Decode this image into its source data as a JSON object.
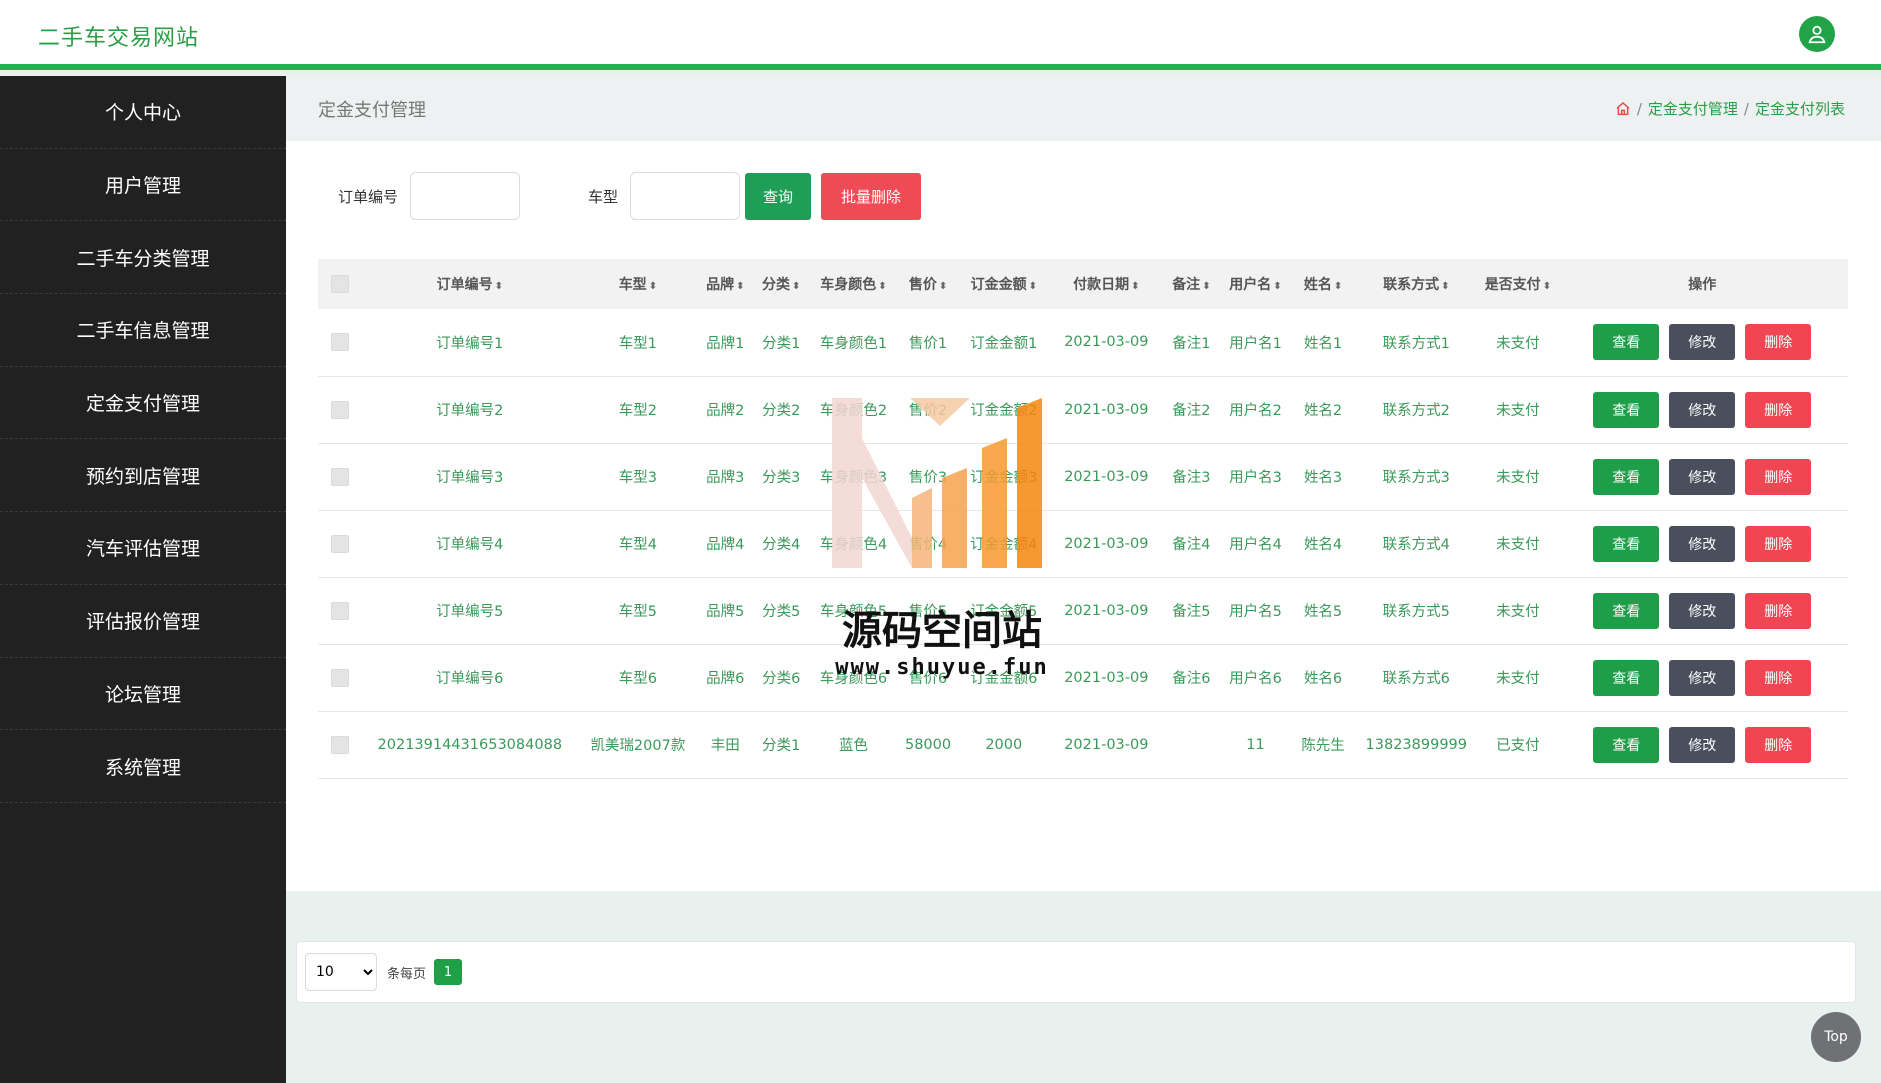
{
  "header": {
    "brand": "二手车交易网站"
  },
  "sidebar": {
    "items": [
      {
        "label": "个人中心"
      },
      {
        "label": "用户管理"
      },
      {
        "label": "二手车分类管理"
      },
      {
        "label": "二手车信息管理"
      },
      {
        "label": "定金支付管理"
      },
      {
        "label": "预约到店管理"
      },
      {
        "label": "汽车评估管理"
      },
      {
        "label": "评估报价管理"
      },
      {
        "label": "论坛管理"
      },
      {
        "label": "系统管理"
      }
    ]
  },
  "page": {
    "title": "定金支付管理",
    "breadcrumb": [
      "定金支付管理",
      "定金支付列表"
    ]
  },
  "search": {
    "order_label": "订单编号",
    "order_value": "",
    "model_label": "车型",
    "model_value": "",
    "query_button": "查询",
    "batch_delete_button": "批量删除"
  },
  "table": {
    "headers": [
      "订单编号",
      "车型",
      "品牌",
      "分类",
      "车身颜色",
      "售价",
      "订金金额",
      "付款日期",
      "备注",
      "用户名",
      "姓名",
      "联系方式",
      "是否支付"
    ],
    "op_header": "操作",
    "actions": {
      "view": "查看",
      "edit": "修改",
      "delete": "删除"
    },
    "rows": [
      [
        "订单编号1",
        "车型1",
        "品牌1",
        "分类1",
        "车身颜色1",
        "售价1",
        "订金金额1",
        "2021-03-09",
        "备注1",
        "用户名1",
        "姓名1",
        "联系方式1",
        "未支付"
      ],
      [
        "订单编号2",
        "车型2",
        "品牌2",
        "分类2",
        "车身颜色2",
        "售价2",
        "订金金额2",
        "2021-03-09",
        "备注2",
        "用户名2",
        "姓名2",
        "联系方式2",
        "未支付"
      ],
      [
        "订单编号3",
        "车型3",
        "品牌3",
        "分类3",
        "车身颜色3",
        "售价3",
        "订金金额3",
        "2021-03-09",
        "备注3",
        "用户名3",
        "姓名3",
        "联系方式3",
        "未支付"
      ],
      [
        "订单编号4",
        "车型4",
        "品牌4",
        "分类4",
        "车身颜色4",
        "售价4",
        "订金金额4",
        "2021-03-09",
        "备注4",
        "用户名4",
        "姓名4",
        "联系方式4",
        "未支付"
      ],
      [
        "订单编号5",
        "车型5",
        "品牌5",
        "分类5",
        "车身颜色5",
        "售价5",
        "订金金额5",
        "2021-03-09",
        "备注5",
        "用户名5",
        "姓名5",
        "联系方式5",
        "未支付"
      ],
      [
        "订单编号6",
        "车型6",
        "品牌6",
        "分类6",
        "车身颜色6",
        "售价6",
        "订金金额6",
        "2021-03-09",
        "备注6",
        "用户名6",
        "姓名6",
        "联系方式6",
        "未支付"
      ],
      [
        "20213914431653084088",
        "凯美瑞2007款",
        "丰田",
        "分类1",
        "蓝色",
        "58000",
        "2000",
        "2021-03-09",
        "",
        "11",
        "陈先生",
        "13823899999",
        "已支付"
      ]
    ]
  },
  "pagination": {
    "page_size": "10",
    "per_page_label": "条每页",
    "current_page": "1"
  },
  "watermark": {
    "name": "源码空间站",
    "url": "www.shuyue.fun"
  },
  "back_to_top": "Top",
  "colors": {
    "brand_green": "#2bae52",
    "sidebar_bg": "#212122",
    "view": "#1f9e4a",
    "edit": "#4a4f5e",
    "delete": "#f04552"
  },
  "icons": {
    "avatar": "user-icon",
    "home": "home-icon",
    "sort": "sort-icon"
  }
}
